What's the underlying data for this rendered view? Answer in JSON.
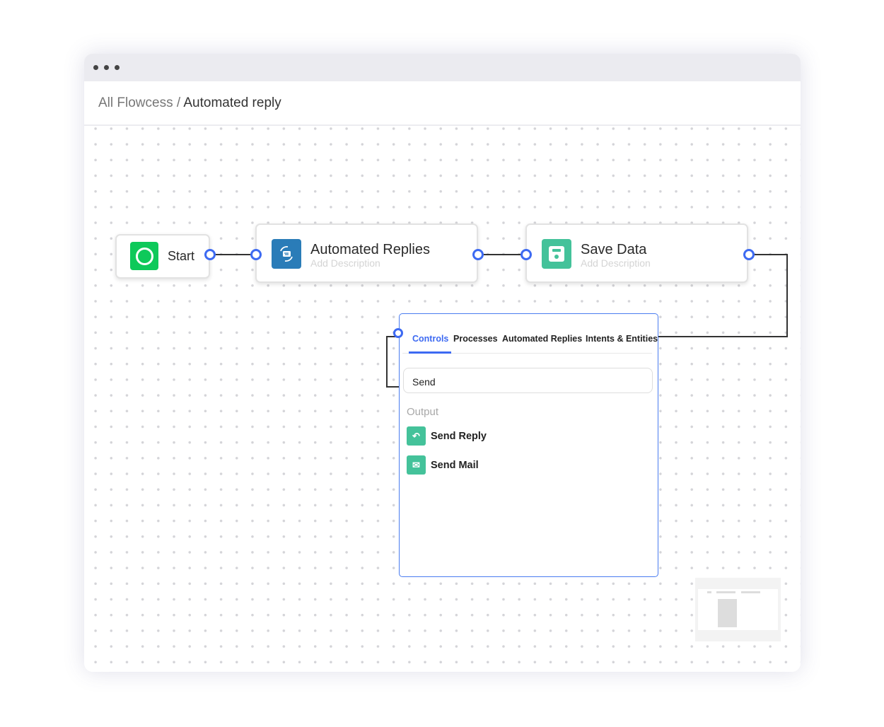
{
  "breadcrumb": {
    "parent": "All Flowcess",
    "separator": "/",
    "current": "Automated reply"
  },
  "nodes": [
    {
      "title": "Start",
      "icon": "circle-icon",
      "color": "#0ec95a"
    },
    {
      "title": "Automated Replies",
      "description": "Add Description",
      "icon": "chat-sync-icon",
      "color": "#2a7cb8"
    },
    {
      "title": "Save Data",
      "description": "Add Description",
      "icon": "floppy-disk-icon",
      "color": "#44c29a"
    }
  ],
  "panel": {
    "tabs": [
      "Controls",
      "Processes",
      "Automated Replies",
      "Intents & Entities"
    ],
    "active_tab": "Controls",
    "search_value": "Send",
    "section_label": "Output",
    "items": [
      {
        "label": "Send Reply",
        "icon": "reply-icon"
      },
      {
        "label": "Send Mail",
        "icon": "mail-icon"
      }
    ]
  },
  "colors": {
    "accent": "#3d6af2",
    "item_icon": "#44c29a"
  }
}
